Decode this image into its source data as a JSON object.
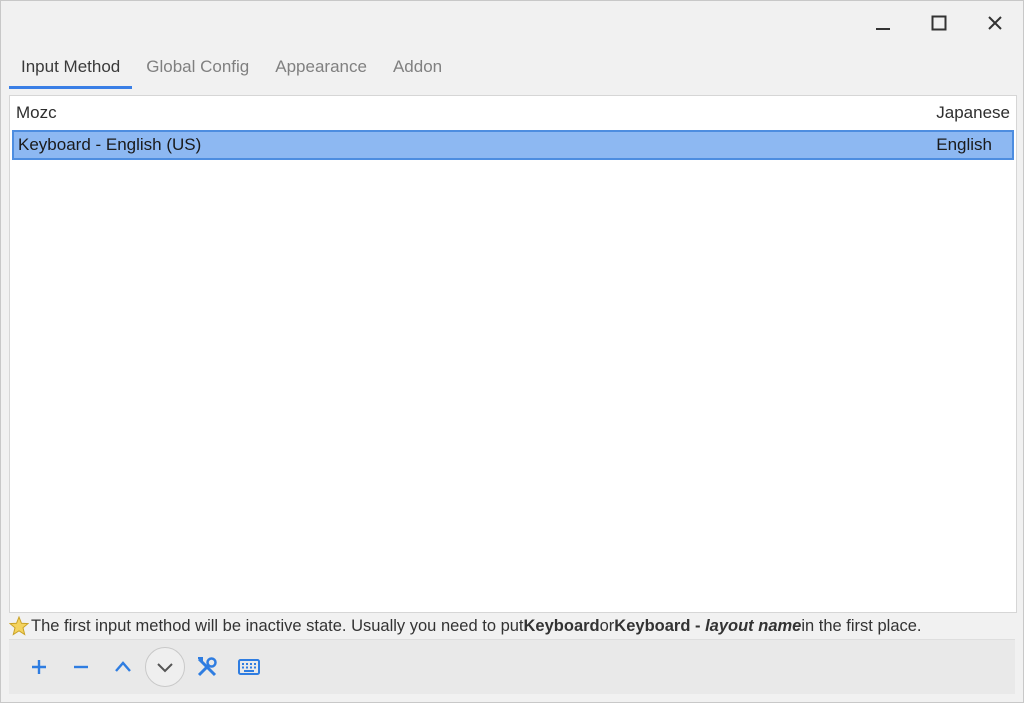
{
  "window": {
    "controls": [
      "minimize-icon",
      "maximize-icon",
      "close-icon"
    ]
  },
  "tabs": [
    {
      "label": "Input Method",
      "active": true
    },
    {
      "label": "Global Config",
      "active": false
    },
    {
      "label": "Appearance",
      "active": false
    },
    {
      "label": "Addon",
      "active": false
    }
  ],
  "input_methods": [
    {
      "name": "Mozc",
      "language": "Japanese",
      "selected": false
    },
    {
      "name": "Keyboard - English (US)",
      "language": "English",
      "selected": true
    }
  ],
  "hint": {
    "icon": "star-icon",
    "part1": "The first input method will be inactive state. Usually you need to put ",
    "kw1": "Keyboard",
    "part2": " or ",
    "kw2": "Keyboard - ",
    "kw2_italic": "layout name",
    "part3": " in the first place."
  },
  "toolbar": {
    "buttons": [
      "add-icon",
      "remove-icon",
      "move-up-icon",
      "move-down-icon",
      "configure-icon",
      "keyboard-layout-icon"
    ]
  },
  "colors": {
    "accent": "#3a7fe6",
    "selection": "#8db8f2",
    "icon_blue": "#2f7de1"
  }
}
